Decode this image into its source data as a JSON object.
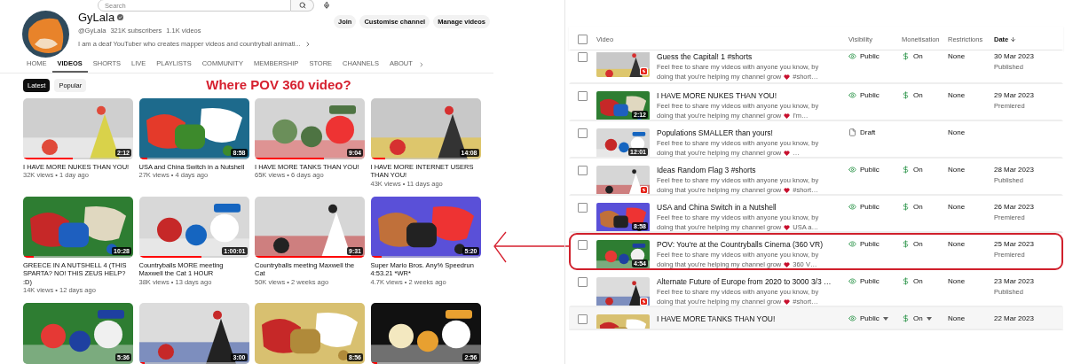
{
  "search": {
    "placeholder": "Search"
  },
  "channel": {
    "name": "GyLala",
    "verified": true,
    "handle": "@GyLala",
    "subscribers": "321K subscribers",
    "videos": "1.1K videos",
    "description": "I am a deaf YouTuber who creates mapper videos and countryball animati...",
    "buttons": [
      "Join",
      "Customise channel",
      "Manage videos"
    ]
  },
  "tabs": [
    {
      "label": "HOME",
      "selected": false
    },
    {
      "label": "VIDEOS",
      "selected": true
    },
    {
      "label": "SHORTS",
      "selected": false
    },
    {
      "label": "LIVE",
      "selected": false
    },
    {
      "label": "PLAYLISTS",
      "selected": false
    },
    {
      "label": "COMMUNITY",
      "selected": false
    },
    {
      "label": "MEMBERSHIP",
      "selected": false
    },
    {
      "label": "STORE",
      "selected": false
    },
    {
      "label": "CHANNELS",
      "selected": false
    },
    {
      "label": "ABOUT",
      "selected": false
    }
  ],
  "chips": [
    {
      "label": "Latest",
      "selected": true
    },
    {
      "label": "Popular",
      "selected": false
    }
  ],
  "annotation": {
    "text": "Where POV 360 video?"
  },
  "videos": [
    {
      "title": "I HAVE MORE NUKES THAN YOU!",
      "meta": "32K views • 1 day ago",
      "duration": "2:12",
      "level": 0.45
    },
    {
      "title": "USA and China Switch in a Nutshell",
      "meta": "27K views • 4 days ago",
      "duration": "8:58",
      "level": 0.08
    },
    {
      "title": "I HAVE MORE TANKS THAN YOU!",
      "meta": "65K views • 6 days ago",
      "duration": "9:04",
      "level": 0.63
    },
    {
      "title": "I HAVE MORE INTERNET USERS THAN YOU!",
      "meta": "43K views • 11 days ago",
      "duration": "14:08",
      "level": 0.13
    },
    {
      "title": "GREECE IN A NUTSHELL 4 (THIS SPARTA? NO! THIS ZEUS HELP? :D)",
      "meta": "14K views • 12 days ago",
      "duration": "10:28",
      "level": 0.1
    },
    {
      "title": "Countryballs MORE meeting Maxwell the Cat 1 HOUR",
      "meta": "38K views • 13 days ago",
      "duration": "1:00:01",
      "level": 0.57
    },
    {
      "title": "Countryballs meeting Maxwell the Cat",
      "meta": "50K views • 2 weeks ago",
      "duration": "9:31",
      "level": 1
    },
    {
      "title": "Super Mario Bros. Any% Speedrun 4:53.21 *WR*",
      "meta": "4.7K views • 2 weeks ago",
      "duration": "5:20",
      "level": 0.1
    },
    {
      "duration": "5:36"
    },
    {
      "duration": "3:00",
      "level": 0.05
    },
    {
      "duration": "8:56"
    },
    {
      "duration": "2:56",
      "level": 0.06
    }
  ],
  "studio": {
    "select_all": {
      "checked": false
    },
    "columns": [
      {
        "label": "Video",
        "sorted": false
      },
      {
        "label": "Visibility",
        "sorted": false
      },
      {
        "label": "Monetisation",
        "sorted": false
      },
      {
        "label": "Restrictions",
        "sorted": false
      },
      {
        "label": "Date",
        "sorted": true
      }
    ],
    "rows": [
      {
        "checked": false,
        "title": "Guess the Capital! 1 #shorts",
        "short": true,
        "description_lines": [
          "Feel free to share my videos with anyone you know, by",
          "doing that you're helping my channel grow"
        ],
        "description_tail": "#short…",
        "visibility": {
          "kind": "public",
          "label": "Public"
        },
        "monetisation": "On",
        "restrictions": "None",
        "date": "30 Mar 2023",
        "status": "Published",
        "circled": false,
        "hovered": false
      },
      {
        "checked": false,
        "title": "I HAVE MORE NUKES THAN YOU!",
        "duration": "2:12",
        "short": false,
        "description_lines": [
          "Feel free to share my videos with anyone you know, by",
          "doing that you're helping my channel grow"
        ],
        "description_tail": "I'm…",
        "visibility": {
          "kind": "public",
          "label": "Public"
        },
        "monetisation": "On",
        "restrictions": "None",
        "date": "29 Mar 2023",
        "status": "Premiered",
        "circled": false,
        "hovered": false
      },
      {
        "checked": false,
        "title": "Populations SMALLER than yours!",
        "duration": "12:01",
        "short": false,
        "description_lines": [
          "Feel free to share my videos with anyone you know, by",
          "doing that you're helping my channel grow"
        ],
        "description_tail": "…",
        "visibility": {
          "kind": "draft",
          "label": "Draft"
        },
        "restrictions": "None",
        "circled": false,
        "hovered": false
      },
      {
        "checked": false,
        "title": "Ideas Random Flag 3 #shorts",
        "short": true,
        "description_lines": [
          "Feel free to share my videos with anyone you know, by",
          "doing that you're helping my channel grow"
        ],
        "description_tail": "#short…",
        "visibility": {
          "kind": "public",
          "label": "Public"
        },
        "monetisation": "On",
        "restrictions": "None",
        "date": "28 Mar 2023",
        "status": "Published",
        "circled": false,
        "hovered": false
      },
      {
        "checked": false,
        "title": "USA and China Switch in a Nutshell",
        "duration": "8:58",
        "short": false,
        "description_lines": [
          "Feel free to share my videos with anyone you know, by",
          "doing that you're helping my channel grow"
        ],
        "description_tail": "USA a…",
        "visibility": {
          "kind": "public",
          "label": "Public"
        },
        "monetisation": "On",
        "restrictions": "None",
        "date": "26 Mar 2023",
        "status": "Premiered",
        "circled": false,
        "hovered": false
      },
      {
        "checked": false,
        "title": "POV: You're at the Countryballs Cinema (360 VR)",
        "duration": "4:54",
        "short": false,
        "description_lines": [
          "Feel free to share my videos with anyone you know, by",
          "doing that you're helping my channel grow"
        ],
        "description_tail": "360 V…",
        "visibility": {
          "kind": "public",
          "label": "Public"
        },
        "monetisation": "On",
        "restrictions": "None",
        "date": "25 Mar 2023",
        "status": "Premiered",
        "circled": true,
        "hovered": false
      },
      {
        "checked": false,
        "title": "Alternate Future of Europe from 2020 to 3000 3/3 …",
        "short": true,
        "description_lines": [
          "Feel free to share my videos with anyone you know, by",
          "doing that you're helping my channel grow"
        ],
        "description_tail": "#short…",
        "visibility": {
          "kind": "public",
          "label": "Public"
        },
        "monetisation": "On",
        "restrictions": "None",
        "date": "23 Mar 2023",
        "status": "Published",
        "circled": false,
        "hovered": false
      },
      {
        "checked": false,
        "title": "I HAVE MORE TANKS THAN YOU!",
        "short": false,
        "visibility": {
          "kind": "public",
          "label": "Public"
        },
        "monetisation": "On",
        "restrictions": "None",
        "date": "22 Mar 2023",
        "circled": false,
        "hovered": true
      }
    ]
  }
}
